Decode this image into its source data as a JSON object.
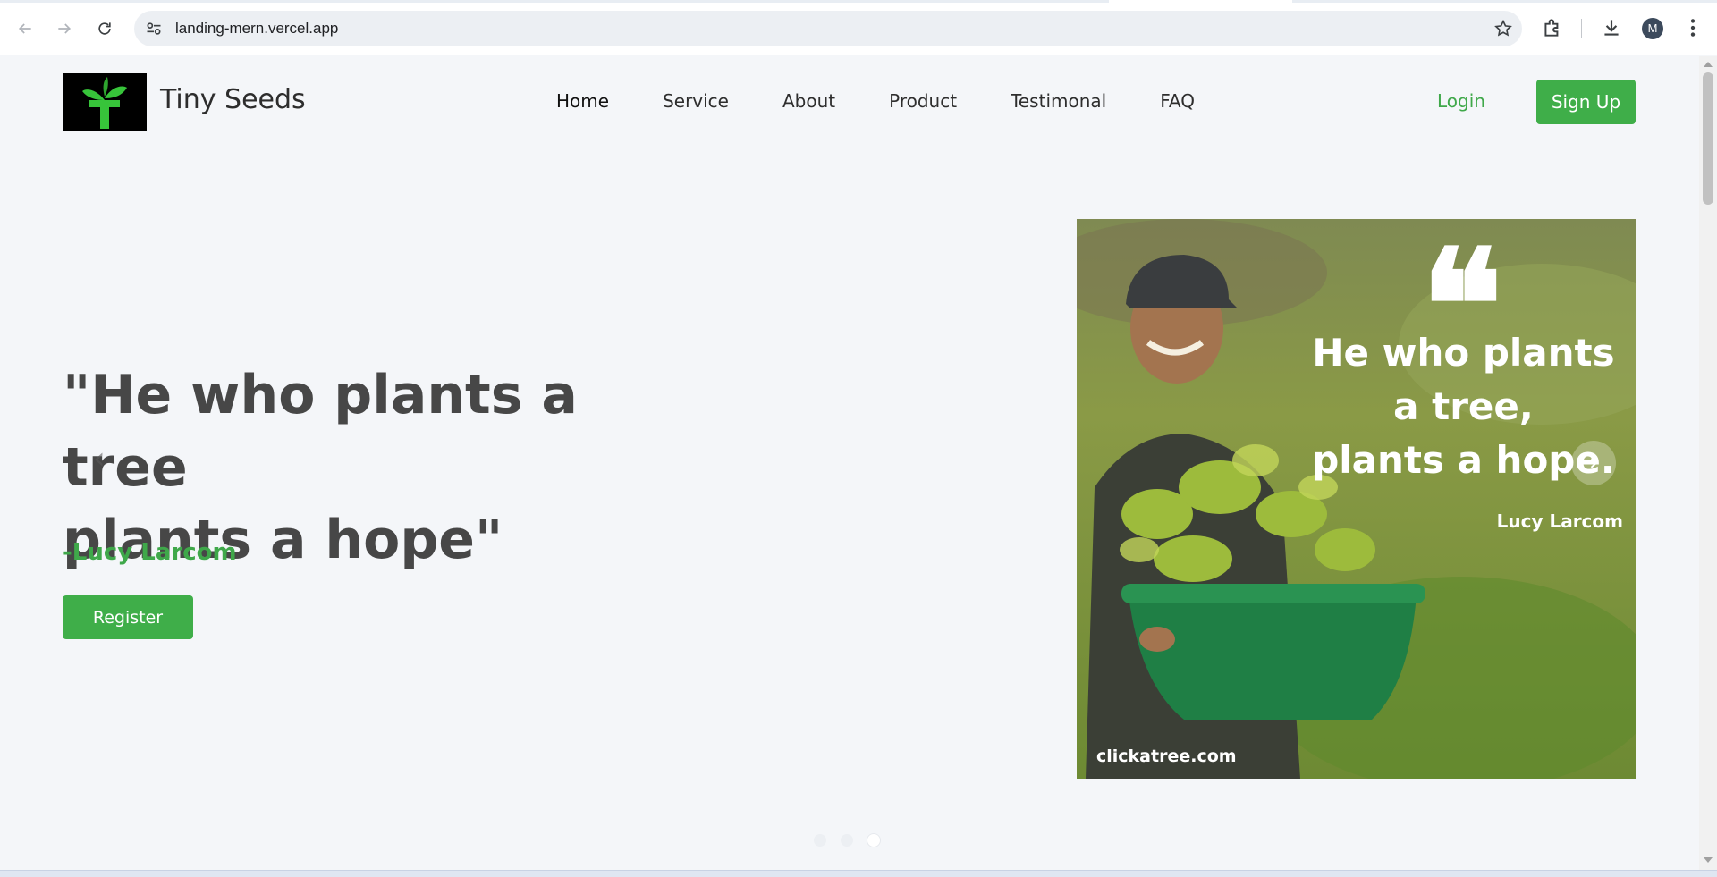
{
  "browser": {
    "url": "landing-mern.vercel.app",
    "profile_initial": "M",
    "icons": [
      "back-icon",
      "forward-icon",
      "reload-icon",
      "site-info-icon",
      "bookmark-star-icon",
      "extensions-icon",
      "download-icon",
      "menu-icon"
    ]
  },
  "header": {
    "brand": "Tiny Seeds",
    "nav": [
      "Home",
      "Service",
      "About",
      "Product",
      "Testimonal",
      "FAQ"
    ],
    "active_nav": "Home",
    "login": "Login",
    "signup": "Sign Up"
  },
  "hero": {
    "quote_line1": "\"He who plants a tree",
    "quote_line2": "plants a hope\"",
    "author": "-Lucy Larcom",
    "register": "Register",
    "prev_arrow": "‹",
    "next_arrow": "›"
  },
  "slide_image": {
    "text_line1": "He who plants",
    "text_line2": "a tree,",
    "text_line3": "plants a hope.",
    "author": "Lucy Larcom",
    "site": "clickatree.com"
  },
  "carousel": {
    "slide_count": 3,
    "active_index": 2
  },
  "colors": {
    "brand_green": "#3fae49",
    "link_green": "#3fa84a",
    "page_bg": "#f4f6f9"
  }
}
